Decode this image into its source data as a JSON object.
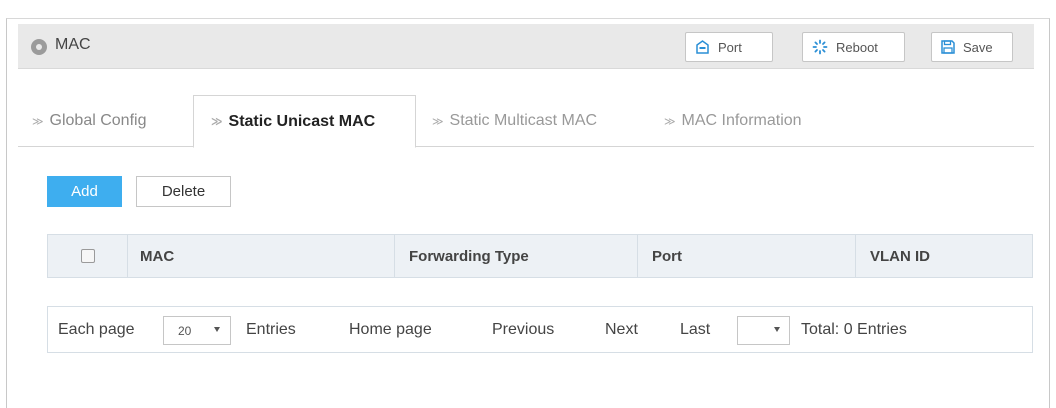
{
  "header": {
    "title": "MAC",
    "buttons": {
      "port": "Port",
      "reboot": "Reboot",
      "save": "Save"
    },
    "icons": {
      "title": "circle-dot-icon",
      "port": "port-icon",
      "reboot": "spinner-icon",
      "save": "floppy-disk-icon"
    }
  },
  "tabs": [
    {
      "label": "Global Config",
      "active": false
    },
    {
      "label": "Static Unicast MAC",
      "active": true
    },
    {
      "label": "Static Multicast MAC",
      "active": false
    },
    {
      "label": "MAC Information",
      "active": false
    }
  ],
  "actions": {
    "add": "Add",
    "delete": "Delete"
  },
  "table": {
    "columns": [
      "MAC",
      "Forwarding Type",
      "Port",
      "VLAN ID"
    ],
    "rows": []
  },
  "pagination": {
    "each_page": "Each page",
    "page_size": "20",
    "entries": "Entries",
    "home": "Home page",
    "previous": "Previous",
    "next": "Next",
    "last": "Last",
    "jump_value": "",
    "total": "Total: 0 Entries"
  },
  "colors": {
    "accent": "#3eaeef",
    "header_bg": "#e9e9e9",
    "table_header_bg": "#edf1f5"
  }
}
